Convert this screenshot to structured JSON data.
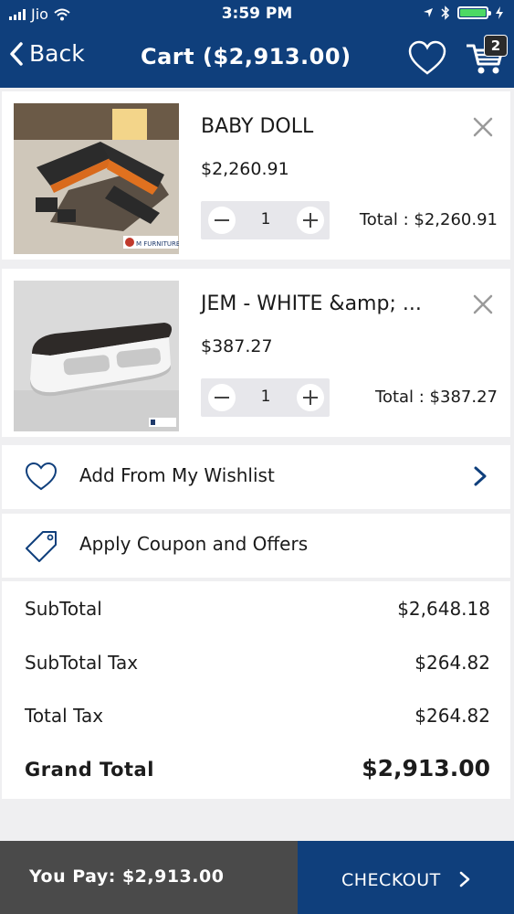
{
  "status_bar": {
    "carrier": "Jio",
    "time": "3:59 PM"
  },
  "nav": {
    "back_label": "Back",
    "title": "Cart ($2,913.00)",
    "cart_count": "2"
  },
  "cart": {
    "items": [
      {
        "name": "BABY DOLL",
        "price": "$2,260.91",
        "quantity": "1",
        "total": "Total : $2,260.91",
        "thumb_badge": "M FURNITURE"
      },
      {
        "name": "JEM - WHITE &amp; ...",
        "price": "$387.27",
        "quantity": "1",
        "total": "Total : $387.27"
      }
    ]
  },
  "actions": {
    "wishlist_label": "Add From My Wishlist",
    "coupon_label": "Apply Coupon and Offers"
  },
  "summary": {
    "subtotal_label": "SubTotal",
    "subtotal_value": "$2,648.18",
    "subtotal_tax_label": "SubTotal Tax",
    "subtotal_tax_value": "$264.82",
    "total_tax_label": "Total Tax",
    "total_tax_value": "$264.82",
    "grand_total_label": "Grand Total",
    "grand_total_value": "$2,913.00"
  },
  "footer": {
    "you_pay": "You Pay: $2,913.00",
    "checkout_label": "CHECKOUT"
  },
  "colors": {
    "brand": "#0f3f7c",
    "footer_dark": "#4a4a4a",
    "background": "#efeff1",
    "battery": "#4cd964"
  }
}
